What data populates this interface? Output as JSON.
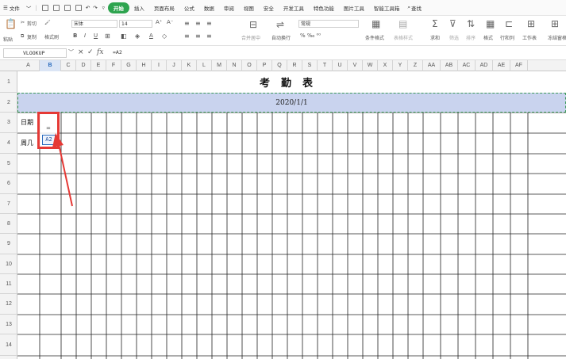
{
  "menubar": {
    "file": "文件",
    "tabs": [
      "开始",
      "插入",
      "页面布局",
      "公式",
      "数据",
      "审阅",
      "视图",
      "安全",
      "开发工具",
      "特色功能",
      "图片工具",
      "智能工具箱"
    ],
    "active_tab": "开始",
    "search": "查找"
  },
  "ribbon": {
    "cut": "剪切",
    "paste": "粘贴",
    "copy": "复制",
    "format_painter": "格式刷",
    "font_name": "宋体",
    "font_size": "14",
    "merge_center": "合并居中",
    "wrap_text": "自动换行",
    "number_format": "常规",
    "cond_format": "条件格式",
    "table_style": "表格样式",
    "sum": "求和",
    "filter": "筛选",
    "sort": "排序",
    "format": "格式",
    "rows_cols": "行和列",
    "worksheet": "工作表",
    "freeze": "冻结窗格"
  },
  "formula_bar": {
    "name_box": "VLOOKUP",
    "formula": "=A2"
  },
  "columns": [
    "A",
    "B",
    "C",
    "D",
    "E",
    "F",
    "G",
    "H",
    "I",
    "J",
    "K",
    "L",
    "M",
    "N",
    "O",
    "P",
    "Q",
    "R",
    "S",
    "T",
    "U",
    "V",
    "W",
    "X",
    "Y",
    "Z",
    "AA",
    "AB",
    "AC",
    "AD",
    "AE",
    "AF"
  ],
  "selected_column": "B",
  "rows": [
    "1",
    "2",
    "3",
    "4",
    "5",
    "6",
    "7",
    "8",
    "9",
    "10",
    "11",
    "12",
    "13",
    "14"
  ],
  "sheet": {
    "title": "考勤表",
    "date": "2020/1/1",
    "row3_label": "日期",
    "row4_label": "周几",
    "editing_prefix": "=",
    "editing_ref": "A2"
  },
  "colors": {
    "accent": "#2ea44f",
    "selection": "#c9d3ee",
    "highlight": "#e53935"
  }
}
